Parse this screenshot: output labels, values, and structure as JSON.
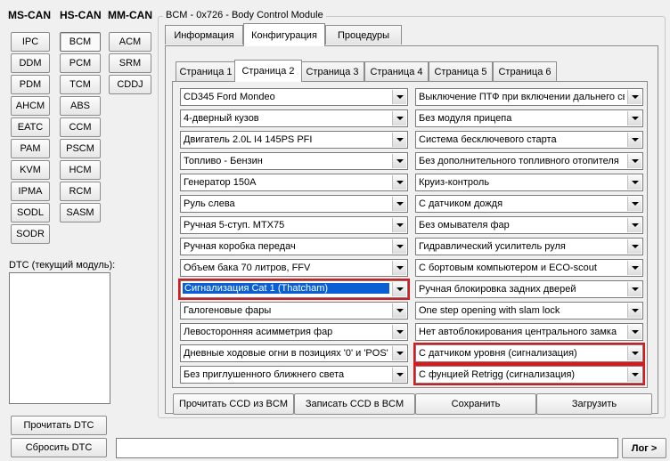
{
  "left": {
    "headers": {
      "ms_can": "MS-CAN",
      "hs_can": "HS-CAN",
      "mm_can": "MM-CAN"
    },
    "ms_buttons": [
      "IPC",
      "DDM",
      "PDM",
      "AHCM",
      "EATC",
      "PAM",
      "KVM",
      "IPMA",
      "SODL",
      "SODR"
    ],
    "hs_buttons": [
      "BCM",
      "PCM",
      "TCM",
      "ABS",
      "CCM",
      "PSCM",
      "HCM",
      "RCM",
      "SASM"
    ],
    "mm_buttons": [
      "ACM",
      "SRM",
      "CDDJ"
    ],
    "dtc_label": "DTC (текущий модуль):",
    "read_dtc": "Прочитать DTC",
    "clear_dtc": "Сбросить DTC"
  },
  "module": {
    "title": "BCM - 0x726 - Body Control Module",
    "tabs": [
      "Информация",
      "Конфигурация",
      "Процедуры"
    ],
    "pages": [
      "Страница 1",
      "Страница 2",
      "Страница 3",
      "Страница 4",
      "Страница 5",
      "Страница 6"
    ],
    "left_options": [
      "CD345 Ford Mondeo",
      "4-дверный кузов",
      "Двигатель 2.0L I4 145PS PFI",
      "Топливо - Бензин",
      "Генератор 150A",
      "Руль слева",
      "Ручная 5-ступ. MTX75",
      "Ручная коробка передач",
      "Объем бака 70 литров, FFV",
      "Сигнализация Cat 1 (Thatcham)",
      "Галогеновые фары",
      "Левосторонняя асимметрия фар",
      "Дневные ходовые огни в позициях '0' и 'POS'",
      "Без приглушенного ближнего света"
    ],
    "right_options": [
      "Выключение ПТФ при включении дальнего света",
      "Без модуля прицепа",
      "Система бесключевого старта",
      "Без дополнительного топливного отопителя",
      "Круиз-контроль",
      "С датчиком дождя",
      "Без омывателя фар",
      "Гидравлический усилитель руля",
      "С бортовым компьютером и ECO-scout",
      "Ручная блокировка задних дверей",
      "One step opening with slam lock",
      "Нет автоблокирования центрального замка",
      "С датчиком уровня (сигнализация)",
      "С фунцией Retrigg (сигнализация)"
    ],
    "actions": {
      "read_ccd": "Прочитать CCD из BCM",
      "write_ccd": "Записать CCD в BCM",
      "save": "Сохранить",
      "load": "Загрузить"
    }
  },
  "bottom": {
    "log_label": "Лог >",
    "log_value": ""
  },
  "colors": {
    "highlight": "#e0161b",
    "selection": "#0a5fd4"
  }
}
